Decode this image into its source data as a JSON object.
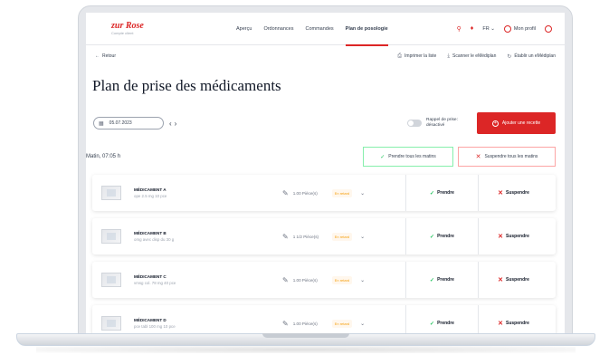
{
  "header": {
    "logo_text": "zur Rose",
    "logo_sub": "Compte client",
    "nav": [
      "Aperçu",
      "Ordonnances",
      "Commandes",
      "Plan de posologie"
    ],
    "active_nav": "Plan de posologie",
    "language": "FR ⌄",
    "profile_label": "Mon profil"
  },
  "toolbar": {
    "back_label": "Retour",
    "actions": [
      "Imprimer la liste",
      "Scanner le eMédiplan",
      "Établir un eMédiplan"
    ]
  },
  "page": {
    "title": "Plan de prise des médicaments",
    "date": "05.07.2023",
    "reminder_label": "Rappel de prise: désactivé",
    "add_prescription": "Ajouter une recette"
  },
  "section": {
    "title": "Matin, 07:05 h",
    "take_all": "Prendre tous les matins",
    "suspend_all": "Suspendre tous les matins"
  },
  "medications": [
    {
      "name": "MÉDICAMENT A",
      "detail": "ope 2.5 mg 10 pce",
      "qty": "1.00 Pièce(s)",
      "badge": "En retard"
    },
    {
      "name": "MÉDICAMENT B",
      "detail": "omg avec disp du 30 g",
      "qty": "1 1/2 Pièce(s)",
      "badge": "En retard"
    },
    {
      "name": "MÉDICAMENT C",
      "detail": "vmsg col. 78 mg 40 pce",
      "qty": "1.00 Pièce(s)",
      "badge": "En retard"
    },
    {
      "name": "MÉDICAMENT D",
      "detail": "pce tabl 100 mg 10 pce",
      "qty": "1.00 Pièce(s)",
      "badge": "En retard"
    }
  ],
  "row_actions": {
    "take": "Prendre",
    "suspend": "Suspendre"
  },
  "colors": {
    "accent_red": "#dc2626",
    "accent_green": "#22c55e"
  }
}
